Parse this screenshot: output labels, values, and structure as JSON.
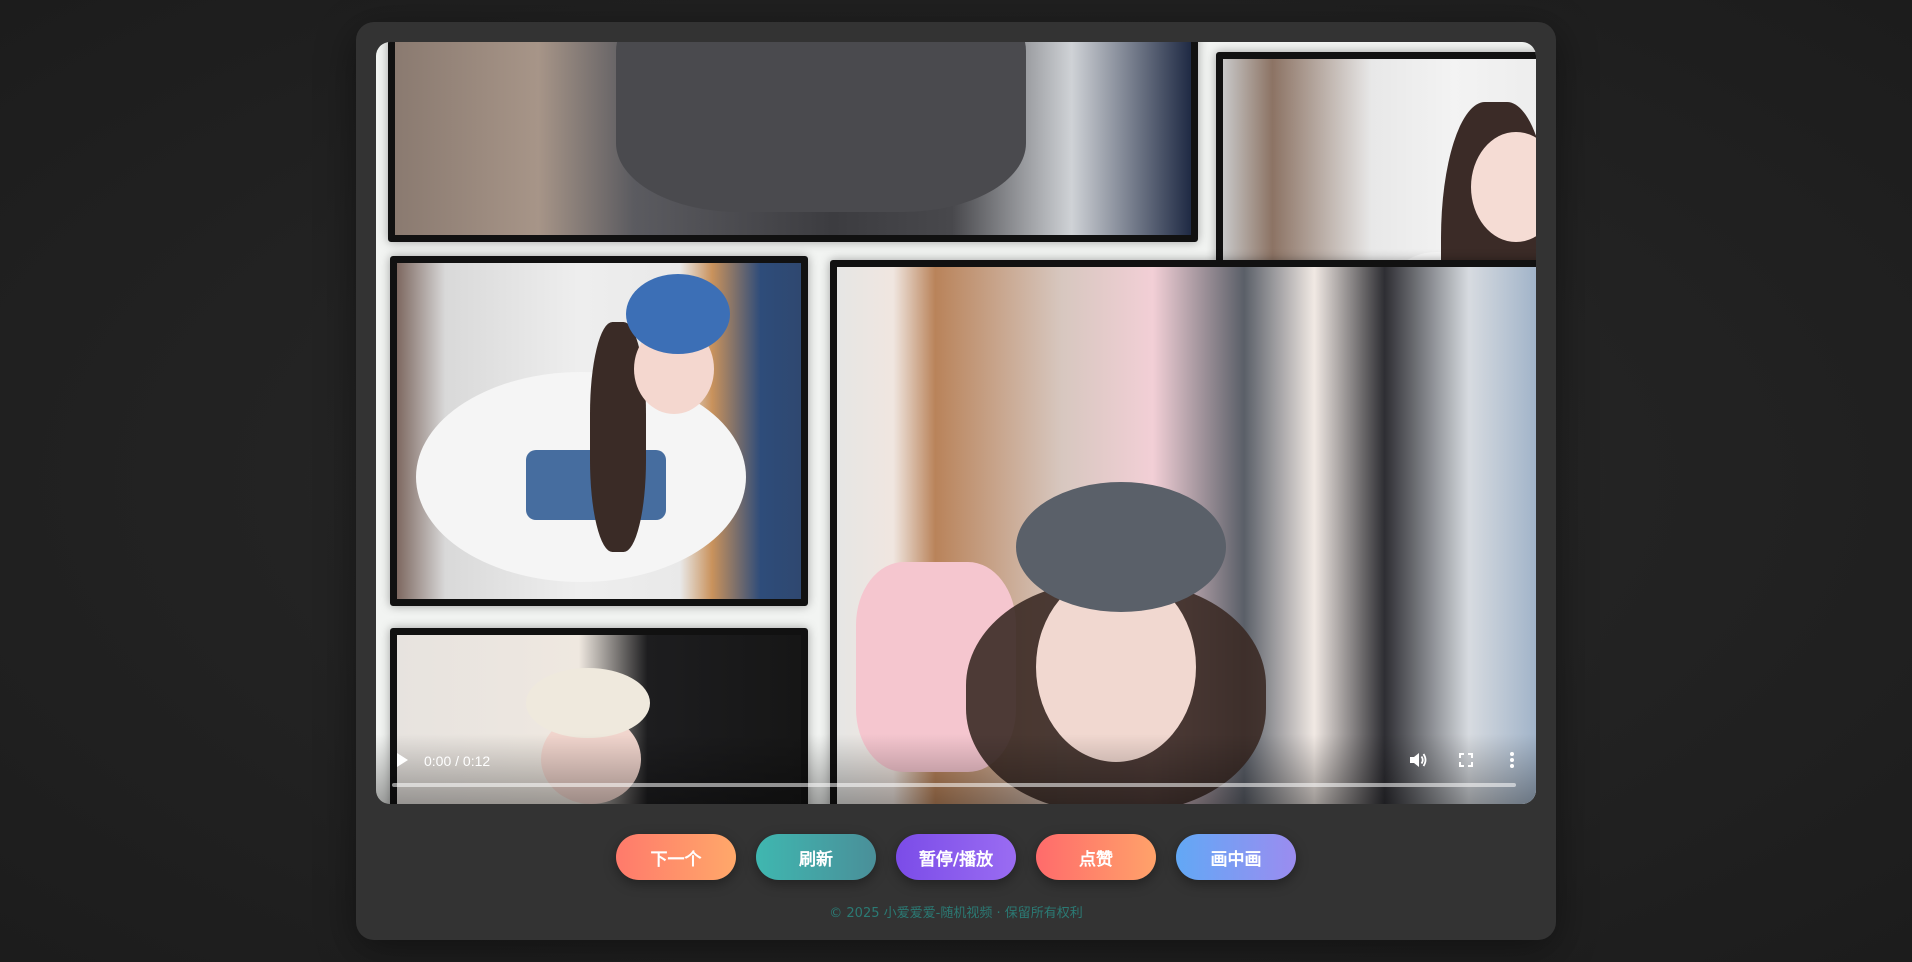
{
  "video": {
    "time_display": "0:00 / 0:12",
    "progress_fraction": 0.0
  },
  "actions": [
    {
      "label": "下一个",
      "icon": "",
      "gradient": [
        "#ff7a6b",
        "#ffa86a"
      ]
    },
    {
      "label": "刷新",
      "icon": "",
      "gradient": [
        "#3fb7b0",
        "#4a8f99"
      ]
    },
    {
      "label": "暂停/播放",
      "icon": "",
      "gradient": [
        "#7b4ce8",
        "#9a6cf2"
      ]
    },
    {
      "label": "点赞",
      "icon": "",
      "gradient": [
        "#ff6b6b",
        "#ffa26a"
      ]
    },
    {
      "label": "画中画",
      "icon": "",
      "gradient": [
        "#62a8f5",
        "#9b8cf0"
      ]
    }
  ],
  "footer": {
    "text": "© 2025 小爱爱爱-随机视频 · 保留所有权利"
  },
  "colors": {
    "page_bg": "#202020",
    "card_bg": "#333333",
    "footer_text": "#2b7a74"
  }
}
